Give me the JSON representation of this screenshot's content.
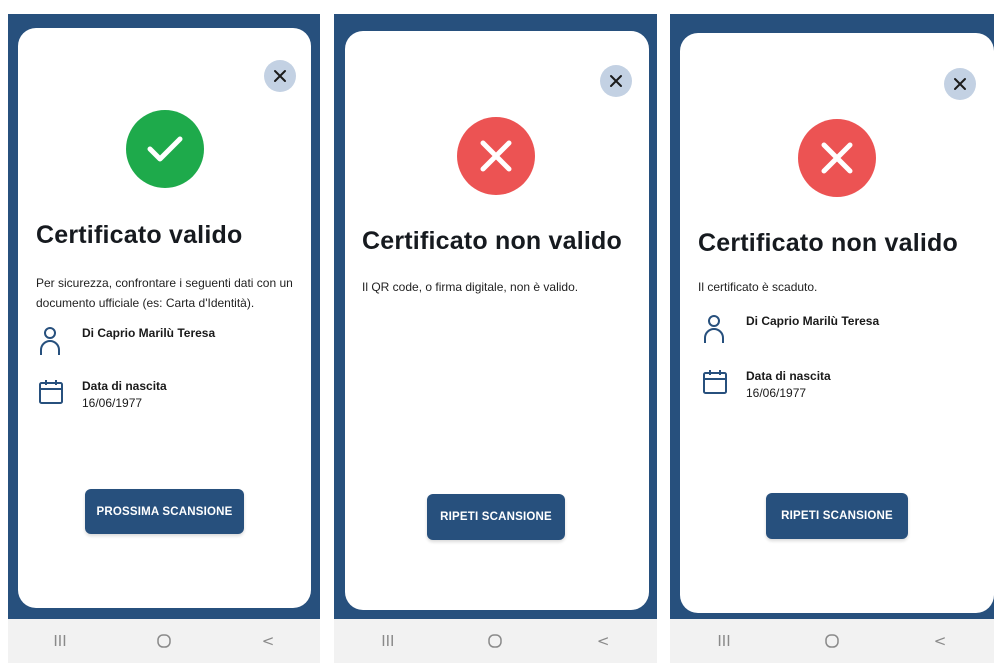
{
  "colors": {
    "brand": "#27507d",
    "success": "#1eaa4b",
    "error": "#ec5353",
    "close_bg": "#c3d1e3"
  },
  "screens": [
    {
      "status": "valid",
      "status_icon": "checkmark-icon",
      "title": "Certificato valido",
      "description": "Per sicurezza, confrontare i seguenti dati con un documento ufficiale (es: Carta d'Identità).",
      "name": "Di Caprio Marilù Teresa",
      "birth_label": "Data di nascita",
      "birth_date": "16/06/1977",
      "button_label": "PROSSIMA SCANSIONE"
    },
    {
      "status": "invalid",
      "status_icon": "cross-icon",
      "title": "Certificato non valido",
      "description": "Il QR code, o firma digitale, non è valido.",
      "button_label": "RIPETI SCANSIONE"
    },
    {
      "status": "expired",
      "status_icon": "cross-icon",
      "title": "Certificato non valido",
      "description": "Il certificato è scaduto.",
      "name": "Di Caprio Marilù Teresa",
      "birth_label": "Data di nascita",
      "birth_date": "16/06/1977",
      "button_label": "RIPETI SCANSIONE"
    }
  ],
  "navbar": {
    "recents_label": "III",
    "home_icon": "home-circle-icon",
    "back_label": "<"
  }
}
